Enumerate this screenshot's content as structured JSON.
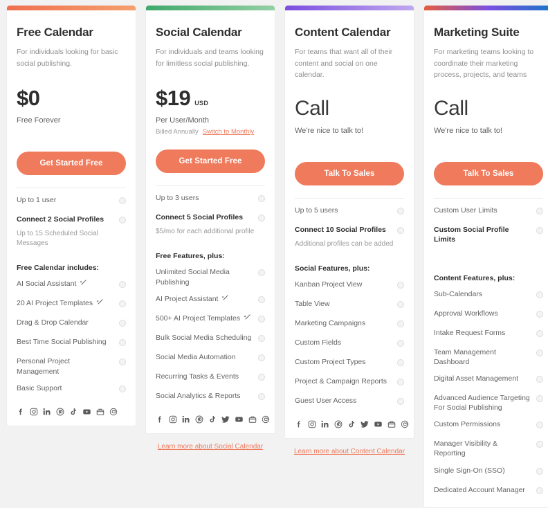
{
  "colors": {
    "accent": "#ef7a5c",
    "card_bg": "#ffffff",
    "page_bg": "#f2f2f2",
    "bar_free": "#ef7050",
    "bar_free_end": "#f5a06d",
    "bar_social": "#3fa96b",
    "bar_social_end": "#95cfa5",
    "bar_content": "#7b4fe0",
    "bar_content_end": "#c0a8ef",
    "bar_marketing_a": "#e35d3f",
    "bar_marketing_b": "#7b4fe0",
    "bar_marketing_c": "#1878c8"
  },
  "plans": [
    {
      "name": "Free Calendar",
      "description": "For individuals looking for basic social publishing.",
      "price": "$0",
      "currency": "",
      "price_sub": "Free Forever",
      "billing_note": "",
      "switch_label": "",
      "cta": "Get Started Free",
      "learn_more": "",
      "features": [
        {
          "text": "Up to 1 user",
          "bold": false,
          "info": true
        },
        {
          "text": "Connect 2 Social Profiles",
          "bold": true,
          "info": true,
          "sub": "Up to 15 Scheduled Social Messages"
        },
        {
          "text": "Free Calendar includes:",
          "group": true
        },
        {
          "text": "AI Social Assistant",
          "ai": true,
          "info": true
        },
        {
          "text": "20 AI Project Templates",
          "ai": true,
          "info": true
        },
        {
          "text": "Drag & Drop Calendar",
          "info": true
        },
        {
          "text": "Best Time Social Publishing",
          "info": true
        },
        {
          "text": "Personal Project Management",
          "info": true
        },
        {
          "text": "Basic Support",
          "info": true
        }
      ],
      "socials": [
        "facebook-icon",
        "instagram-icon",
        "linkedin-icon",
        "pinterest-icon",
        "tiktok-icon",
        "youtube-icon",
        "google-business-icon",
        "mastodon-icon"
      ]
    },
    {
      "name": "Social Calendar",
      "description": "For individuals and teams looking for limitless social publishing.",
      "price": "$19",
      "currency": "USD",
      "price_sub": "Per User/Month",
      "billing_note": "Billed Annually",
      "switch_label": "Switch to Monthly",
      "cta": "Get Started Free",
      "learn_more": "Learn more about Social Calendar",
      "features": [
        {
          "text": "Up to 3 users",
          "bold": false,
          "info": true
        },
        {
          "text": "Connect 5 Social Profiles",
          "bold": true,
          "info": true,
          "sub": "$5/mo for each additional profile"
        },
        {
          "text": "Free Features, plus:",
          "group": true
        },
        {
          "text": "Unlimited Social Media Publishing",
          "info": true
        },
        {
          "text": "AI Project Assistant",
          "ai": true,
          "info": true
        },
        {
          "text": "500+ AI Project Templates",
          "ai": true,
          "info": true
        },
        {
          "text": "Bulk Social Media Scheduling",
          "info": true
        },
        {
          "text": "Social Media Automation",
          "info": true
        },
        {
          "text": "Recurring Tasks & Events",
          "info": true
        },
        {
          "text": "Social Analytics & Reports",
          "info": true
        }
      ],
      "socials": [
        "facebook-icon",
        "instagram-icon",
        "linkedin-icon",
        "pinterest-icon",
        "tiktok-icon",
        "twitter-icon",
        "youtube-icon",
        "google-business-icon",
        "mastodon-icon"
      ]
    },
    {
      "name": "Content Calendar",
      "description": "For teams that want all of their content and social on one calendar.",
      "price": "Call",
      "currency": "",
      "price_sub": "We're nice to talk to!",
      "billing_note": "",
      "switch_label": "",
      "cta": "Talk To Sales",
      "learn_more": "Learn more about Content Calendar",
      "features": [
        {
          "text": "Up to 5 users",
          "bold": false,
          "info": true
        },
        {
          "text": "Connect 10 Social Profiles",
          "bold": true,
          "info": true,
          "sub": "Additional profiles can be added"
        },
        {
          "text": "Social Features, plus:",
          "group": true
        },
        {
          "text": "Kanban Project View",
          "info": true
        },
        {
          "text": "Table View",
          "info": true
        },
        {
          "text": "Marketing Campaigns",
          "info": true
        },
        {
          "text": "Custom Fields",
          "info": true
        },
        {
          "text": "Custom Project Types",
          "info": true
        },
        {
          "text": "Project & Campaign Reports",
          "info": true
        },
        {
          "text": "Guest User Access",
          "info": true
        }
      ],
      "socials": [
        "facebook-icon",
        "instagram-icon",
        "linkedin-icon",
        "pinterest-icon",
        "tiktok-icon",
        "twitter-icon",
        "youtube-icon",
        "google-business-icon",
        "mastodon-icon"
      ]
    },
    {
      "name": "Marketing Suite",
      "description": "For marketing teams looking to coordinate their marketing process, projects, and teams",
      "price": "Call",
      "currency": "",
      "price_sub": "We're nice to talk to!",
      "billing_note": "",
      "switch_label": "",
      "cta": "Talk To Sales",
      "learn_more": "",
      "features": [
        {
          "text": "Custom User Limits",
          "bold": false,
          "info": true
        },
        {
          "text": "Custom Social Profile Limits",
          "bold": true,
          "info": true,
          "sub": ""
        },
        {
          "text": "Content Features, plus:",
          "group": true
        },
        {
          "text": "Sub-Calendars",
          "info": true
        },
        {
          "text": "Approval Workflows",
          "info": true
        },
        {
          "text": "Intake Request Forms",
          "info": true
        },
        {
          "text": "Team Management Dashboard",
          "info": true
        },
        {
          "text": "Digital Asset Management",
          "info": true
        },
        {
          "text": "Advanced Audience Targeting For Social Publishing",
          "info": true
        },
        {
          "text": "Custom Permissions",
          "info": true
        },
        {
          "text": "Manager Visibility & Reporting",
          "info": true
        },
        {
          "text": "Single Sign-On (SSO)",
          "info": true
        },
        {
          "text": "Dedicated Account Manager",
          "info": true
        }
      ],
      "socials": []
    }
  ]
}
